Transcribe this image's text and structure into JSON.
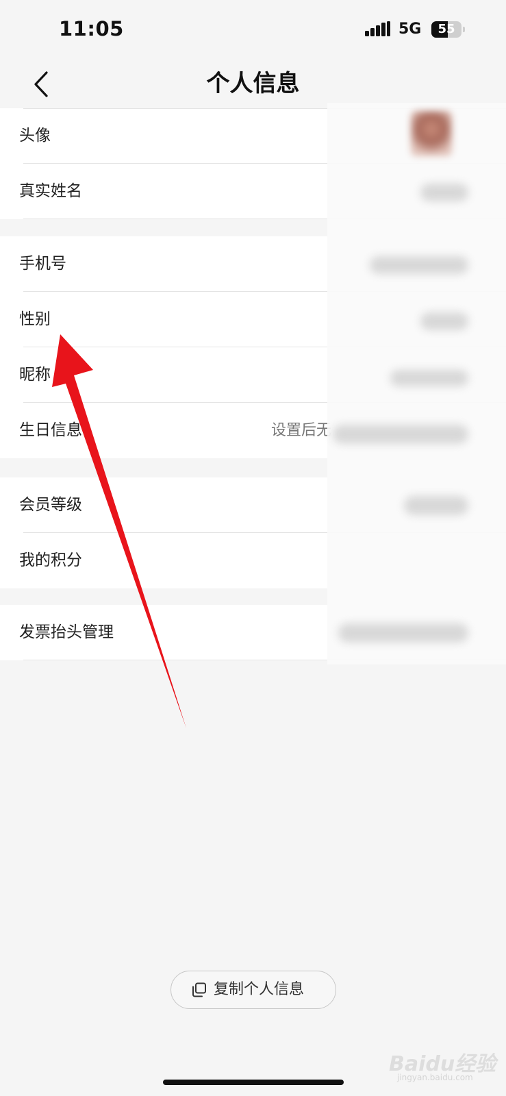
{
  "status_bar": {
    "time": "11:05",
    "network": "5G",
    "battery_level": "55",
    "battery_fraction": 0.55
  },
  "nav": {
    "title": "个人信息",
    "back_icon": "chevron-left-icon"
  },
  "groups": [
    {
      "rows": [
        {
          "label": "头像",
          "value": ""
        },
        {
          "label": "真实姓名",
          "value": ""
        }
      ]
    },
    {
      "rows": [
        {
          "label": "手机号",
          "value": ""
        },
        {
          "label": "性别",
          "value": ""
        },
        {
          "label": "昵称",
          "value": ""
        },
        {
          "label": "生日信息",
          "value": "设置后无"
        }
      ]
    },
    {
      "rows": [
        {
          "label": "会员等级",
          "value": ""
        },
        {
          "label": "我的积分",
          "value": ""
        }
      ]
    },
    {
      "rows": [
        {
          "label": "发票抬头管理",
          "value": ""
        }
      ]
    }
  ],
  "copy_button": {
    "label": "复制个人信息",
    "icon": "copy-icon"
  },
  "watermark": {
    "text": "Baidu经验",
    "sub": "jingyan.baidu.com"
  },
  "annotation": {
    "color": "#e8141b",
    "points_to": "性别"
  }
}
